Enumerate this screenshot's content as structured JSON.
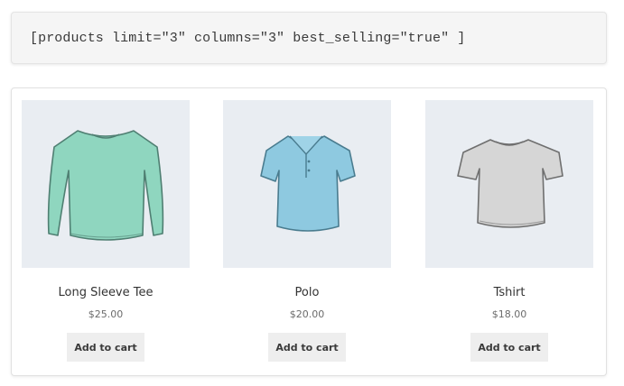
{
  "shortcode": {
    "text": "[products limit=\"3\" columns=\"3\" best_selling=\"true\" ]"
  },
  "products": [
    {
      "title": "Long Sleeve Tee",
      "price": "$25.00",
      "button_label": "Add to cart",
      "image_icon": "long-sleeve-tee-icon",
      "color": "#8fd6bf"
    },
    {
      "title": "Polo",
      "price": "$20.00",
      "button_label": "Add to cart",
      "image_icon": "polo-shirt-icon",
      "color": "#8ec9e0"
    },
    {
      "title": "Tshirt",
      "price": "$18.00",
      "button_label": "Add to cart",
      "image_icon": "tshirt-icon",
      "color": "#d6d6d6"
    }
  ]
}
